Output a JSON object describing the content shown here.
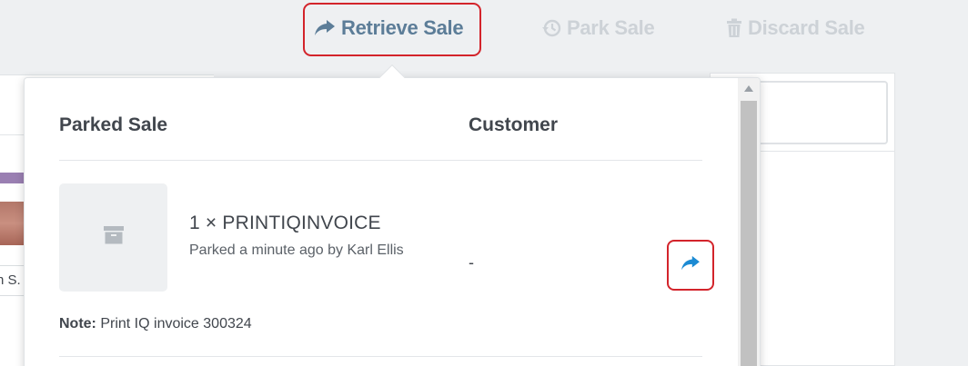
{
  "toolbar": {
    "retrieve_label": "Retrieve Sale",
    "park_label": "Park Sale",
    "discard_label": "Discard Sale"
  },
  "background": {
    "product_caption": "n S."
  },
  "popover": {
    "headers": {
      "sale": "Parked Sale",
      "customer": "Customer"
    },
    "sale": {
      "title": "1 × PRINTIQINVOICE",
      "subtitle": "Parked a minute ago by Karl Ellis",
      "customer": "-",
      "note_label": "Note:",
      "note_text": " Print IQ invoice 300324"
    }
  },
  "icons": {
    "retrieve": "share-arrow-icon",
    "park": "history-icon",
    "discard": "trash-icon",
    "thumbnail": "archive-box-icon"
  },
  "colors": {
    "accent": "#5c7d98",
    "action_blue": "#1b8ad3",
    "highlight_red": "#d3242b",
    "disabled": "#cdd2d7"
  }
}
